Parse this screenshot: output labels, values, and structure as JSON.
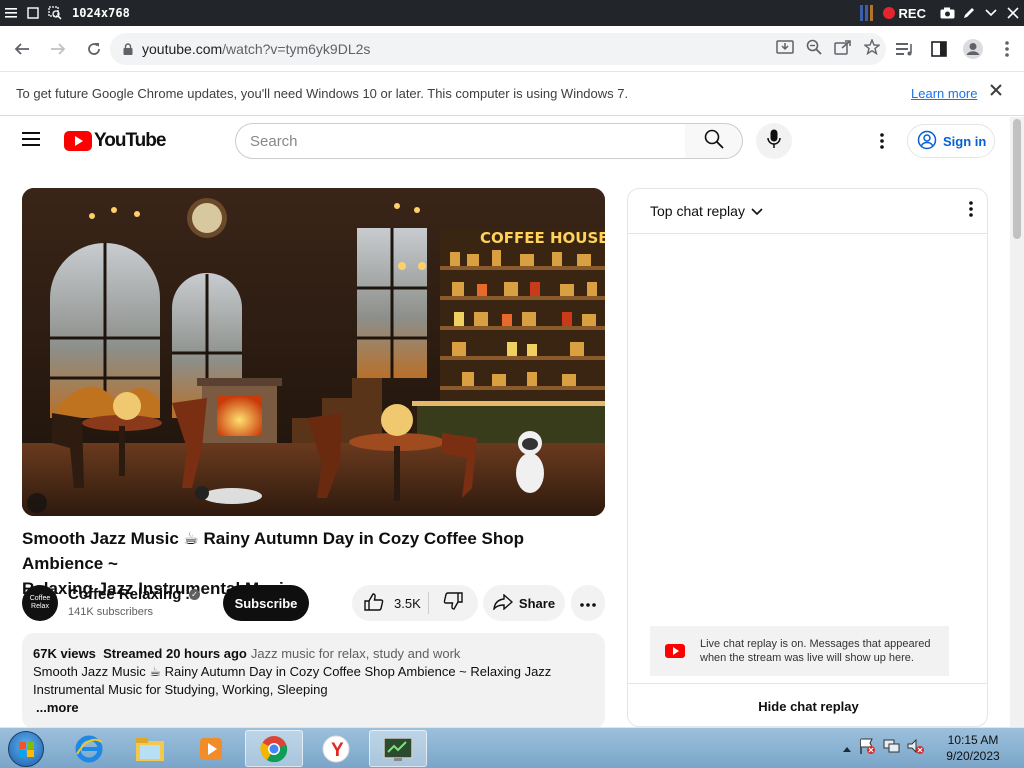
{
  "recorder": {
    "size_label": "1024x768",
    "rec_label": "REC"
  },
  "browser": {
    "url_host": "youtube.com",
    "url_path": "/watch?v=tym6yk9DL2s",
    "infobar_message": "To get future Google Chrome updates, you'll need Windows 10 or later. This computer is using Windows 7.",
    "infobar_link": "Learn more"
  },
  "masthead": {
    "logo_text": "YouTube",
    "search_placeholder": "Search",
    "signin_label": "Sign in"
  },
  "video": {
    "sign_text": "COFFEE HOUSE",
    "title_line1": "Smooth Jazz Music ☕ Rainy Autumn Day in Cozy Coffee Shop Ambience ~",
    "title_line2": "Relaxing Jazz Instrumental Music"
  },
  "owner": {
    "avatar_text": "Coffee Relax",
    "channel_name": "Coffee Relaxing ...",
    "subscribers": "141K subscribers",
    "subscribe_label": "Subscribe",
    "likes": "3.5K",
    "share_label": "Share"
  },
  "description": {
    "views": "67K views",
    "streamed": "Streamed 20 hours ago",
    "tag": "Jazz music for relax, study and work",
    "line1": "Smooth Jazz Music ☕ Rainy Autumn Day in Cozy Coffee Shop Ambience ~ Relaxing Jazz",
    "line2": "Instrumental Music for Studying, Working, Sleeping",
    "more": "...more"
  },
  "chat": {
    "header": "Top chat replay",
    "notice_line1": "Live chat replay is on. Messages that appeared",
    "notice_line2": "when the stream was live will show up here.",
    "hide_label": "Hide chat replay"
  },
  "taskbar": {
    "time": "10:15 AM",
    "date": "9/20/2023"
  },
  "colors": {
    "youtube_red": "#ff0000",
    "link_blue": "#1a73e8",
    "signin_blue": "#065fd4"
  }
}
